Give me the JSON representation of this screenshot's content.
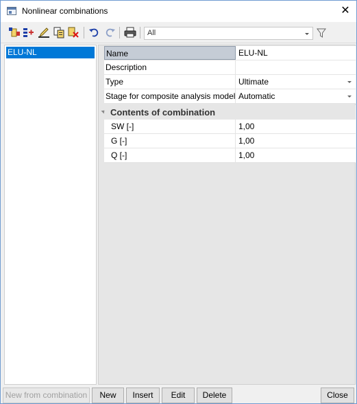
{
  "window": {
    "title": "Nonlinear combinations"
  },
  "toolbar": {
    "icons": [
      "new-icon",
      "insert-icon",
      "edit-icon",
      "copy-icon",
      "delete-icon",
      "undo-icon",
      "redo-icon",
      "print-icon",
      "filter-icon"
    ],
    "filter_value": "All"
  },
  "list": {
    "items": [
      {
        "label": "ELU-NL",
        "selected": true
      }
    ]
  },
  "properties": {
    "name": {
      "label": "Name",
      "value": "ELU-NL"
    },
    "description": {
      "label": "Description",
      "value": ""
    },
    "type": {
      "label": "Type",
      "value": "Ultimate"
    },
    "stage": {
      "label": "Stage for composite analysis model",
      "value": "Automatic"
    },
    "group": {
      "label": "Contents of combination"
    },
    "factors": [
      {
        "label": "SW [-]",
        "value": "1,00"
      },
      {
        "label": "G [-]",
        "value": "1,00"
      },
      {
        "label": "Q [-]",
        "value": "1,00"
      }
    ]
  },
  "buttons": {
    "new_from_combination": "New from combination",
    "new": "New",
    "insert": "Insert",
    "edit": "Edit",
    "delete": "Delete",
    "close": "Close"
  },
  "colors": {
    "selection": "#0078d7",
    "window_border": "#6f9bd1"
  }
}
